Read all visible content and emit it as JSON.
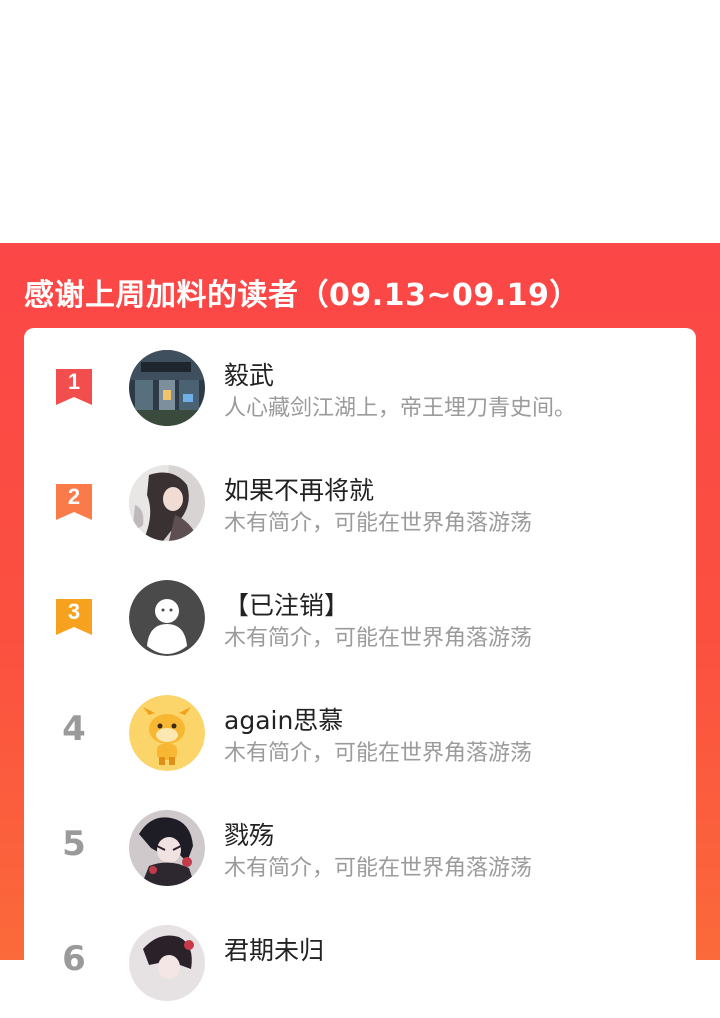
{
  "header": {
    "title": "感谢上周加料的读者（09.13~09.19）"
  },
  "colors": {
    "panel_red": "#fb4747",
    "rank1": "#f24e4e",
    "rank2": "#fb7a4a",
    "rank3": "#f7a21e",
    "rank_plain": "#9a9a9a"
  },
  "readers": [
    {
      "rank": "1",
      "name": "毅武",
      "bio": "人心藏剑江湖上，帝王埋刀青史间。",
      "avatar_icon": "night-street-avatar"
    },
    {
      "rank": "2",
      "name": "如果不再将就",
      "bio": "木有简介，可能在世界角落游荡",
      "avatar_icon": "anime-figure-avatar"
    },
    {
      "rank": "3",
      "name": "【已注销】",
      "bio": "木有简介，可能在世界角落游荡",
      "avatar_icon": "default-user-avatar"
    },
    {
      "rank": "4",
      "name": "again思慕",
      "bio": "木有简介，可能在世界角落游荡",
      "avatar_icon": "cartoon-calf-avatar"
    },
    {
      "rank": "5",
      "name": "戮殇",
      "bio": "木有简介，可能在世界角落游荡",
      "avatar_icon": "anime-character-avatar"
    },
    {
      "rank": "6",
      "name": "君期未归",
      "bio": "",
      "avatar_icon": "anime-character-avatar"
    }
  ]
}
